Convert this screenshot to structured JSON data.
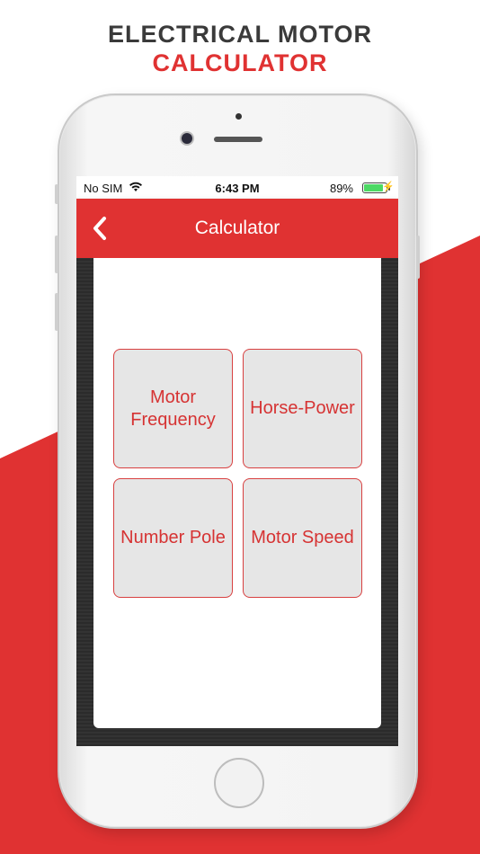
{
  "promo": {
    "line1": "ELECTRICAL MOTOR",
    "line2": "CALCULATOR"
  },
  "colors": {
    "accent": "#e03232",
    "tile_bg": "#e6e6e6",
    "tile_text": "#d63333"
  },
  "status_bar": {
    "carrier": "No SIM",
    "time": "6:43 PM",
    "battery": "89%",
    "battery_level": 0.89
  },
  "app_bar": {
    "title": "Calculator",
    "back_icon": "chevron-left-icon"
  },
  "tiles": [
    {
      "label": "Motor Frequency"
    },
    {
      "label": "Horse-Power"
    },
    {
      "label": "Number Pole"
    },
    {
      "label": "Motor Speed"
    }
  ]
}
